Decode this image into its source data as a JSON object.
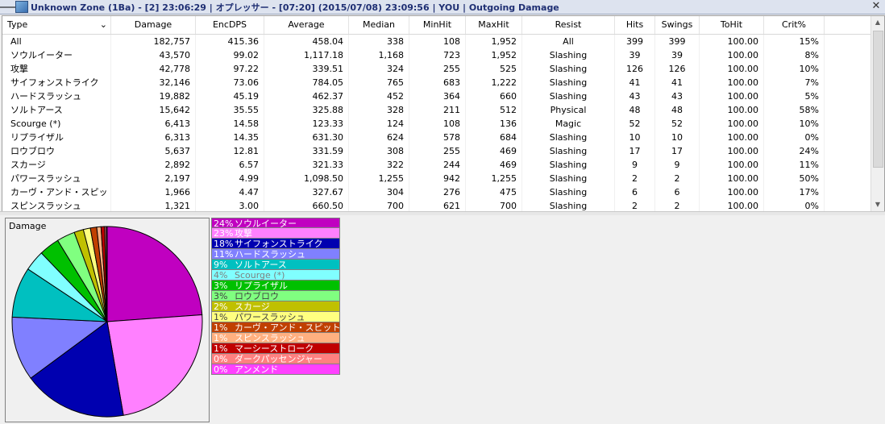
{
  "window": {
    "title": "Unknown Zone (1Ba) - [2] 23:06:29 | オプレッサー - [07:20] (2015/07/08) 23:09:56 | YOU | Outgoing Damage"
  },
  "columns": [
    "Type",
    "Damage",
    "EncDPS",
    "Average",
    "Median",
    "MinHit",
    "MaxHit",
    "Resist",
    "Hits",
    "Swings",
    "ToHit",
    "Crit%"
  ],
  "rows": [
    [
      "All",
      "182,757",
      "415.36",
      "458.04",
      "338",
      "108",
      "1,952",
      "All",
      "399",
      "399",
      "100.00",
      "15%"
    ],
    [
      "ソウルイーター",
      "43,570",
      "99.02",
      "1,117.18",
      "1,168",
      "723",
      "1,952",
      "Slashing",
      "39",
      "39",
      "100.00",
      "8%"
    ],
    [
      "攻撃",
      "42,778",
      "97.22",
      "339.51",
      "324",
      "255",
      "525",
      "Slashing",
      "126",
      "126",
      "100.00",
      "10%"
    ],
    [
      "サイフォンストライク",
      "32,146",
      "73.06",
      "784.05",
      "765",
      "683",
      "1,222",
      "Slashing",
      "41",
      "41",
      "100.00",
      "7%"
    ],
    [
      "ハードスラッシュ",
      "19,882",
      "45.19",
      "462.37",
      "452",
      "364",
      "660",
      "Slashing",
      "43",
      "43",
      "100.00",
      "5%"
    ],
    [
      "ソルトアース",
      "15,642",
      "35.55",
      "325.88",
      "328",
      "211",
      "512",
      "Physical",
      "48",
      "48",
      "100.00",
      "58%"
    ],
    [
      "Scourge (*)",
      "6,413",
      "14.58",
      "123.33",
      "124",
      "108",
      "136",
      "Magic",
      "52",
      "52",
      "100.00",
      "10%"
    ],
    [
      "リプライザル",
      "6,313",
      "14.35",
      "631.30",
      "624",
      "578",
      "684",
      "Slashing",
      "10",
      "10",
      "100.00",
      "0%"
    ],
    [
      "ロウブロウ",
      "5,637",
      "12.81",
      "331.59",
      "308",
      "255",
      "469",
      "Slashing",
      "17",
      "17",
      "100.00",
      "24%"
    ],
    [
      "スカージ",
      "2,892",
      "6.57",
      "321.33",
      "322",
      "244",
      "469",
      "Slashing",
      "9",
      "9",
      "100.00",
      "11%"
    ],
    [
      "パワースラッシュ",
      "2,197",
      "4.99",
      "1,098.50",
      "1,255",
      "942",
      "1,255",
      "Slashing",
      "2",
      "2",
      "100.00",
      "50%"
    ],
    [
      "カーヴ・アンド・スピット",
      "1,966",
      "4.47",
      "327.67",
      "304",
      "276",
      "475",
      "Slashing",
      "6",
      "6",
      "100.00",
      "17%"
    ],
    [
      "スピンスラッシュ",
      "1,321",
      "3.00",
      "660.50",
      "700",
      "621",
      "700",
      "Slashing",
      "2",
      "2",
      "100.00",
      "0%"
    ]
  ],
  "pie": {
    "title": "Damage",
    "slices": [
      {
        "pct": 24,
        "label": "ソウルイーター",
        "color": "#c000c0",
        "text": "#ffffff"
      },
      {
        "pct": 23,
        "label": "攻撃",
        "color": "#ff80ff",
        "text": "#ffffff"
      },
      {
        "pct": 18,
        "label": "サイフォンストライク",
        "color": "#0000b0",
        "text": "#ffffff"
      },
      {
        "pct": 11,
        "label": "ハードスラッシュ",
        "color": "#8080ff",
        "text": "#ffffff"
      },
      {
        "pct": 9,
        "label": "ソルトアース",
        "color": "#00c0c0",
        "text": "#ffffff"
      },
      {
        "pct": 4,
        "label": "Scourge (*)",
        "color": "#80ffff",
        "text": "#808080"
      },
      {
        "pct": 3,
        "label": "リプライザル",
        "color": "#00c000",
        "text": "#ffffff"
      },
      {
        "pct": 3,
        "label": "ロウブロウ",
        "color": "#80ff80",
        "text": "#404040"
      },
      {
        "pct": 2,
        "label": "スカージ",
        "color": "#c0c000",
        "text": "#ffffff"
      },
      {
        "pct": 1,
        "label": "パワースラッシュ",
        "color": "#ffff80",
        "text": "#404040"
      },
      {
        "pct": 1,
        "label": "カーヴ・アンド・スピット",
        "color": "#c04000",
        "text": "#ffffff"
      },
      {
        "pct": 1,
        "label": "スピンスラッシュ",
        "color": "#ffb080",
        "text": "#ffffff"
      },
      {
        "pct": 1,
        "label": "マーシーストローク",
        "color": "#c00000",
        "text": "#ffffff"
      },
      {
        "pct": 0,
        "label": "ダークパッセンジャー",
        "color": "#ff8080",
        "text": "#ffffff"
      },
      {
        "pct": 0,
        "label": "アンメンド",
        "color": "#ff40ff",
        "text": "#ffffff"
      }
    ]
  },
  "chart_data": {
    "type": "pie",
    "title": "Damage",
    "categories": [
      "ソウルイーター",
      "攻撃",
      "サイフォンストライク",
      "ハードスラッシュ",
      "ソルトアース",
      "Scourge (*)",
      "リプライザル",
      "ロウブロウ",
      "スカージ",
      "パワースラッシュ",
      "カーヴ・アンド・スピット",
      "スピンスラッシュ",
      "マーシーストローク",
      "ダークパッセンジャー",
      "アンメンド"
    ],
    "values": [
      43570,
      42778,
      32146,
      19882,
      15642,
      6413,
      6313,
      5637,
      2892,
      2197,
      1966,
      1321,
      1100,
      500,
      300
    ]
  }
}
